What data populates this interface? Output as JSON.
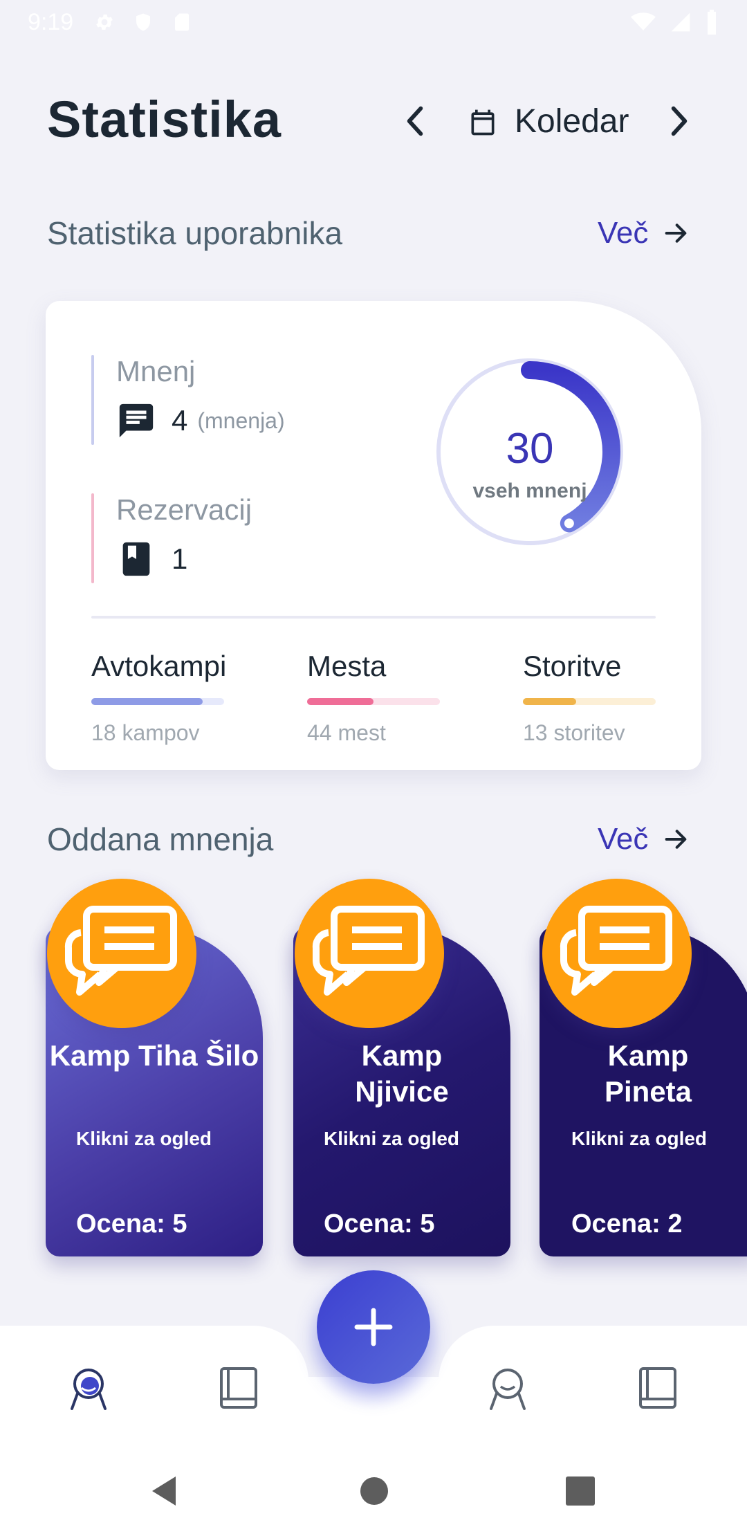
{
  "status_bar": {
    "time": "9:19"
  },
  "header": {
    "title": "Statistika",
    "calendar_label": "Koledar"
  },
  "user_stats": {
    "section_title": "Statistika uporabnika",
    "more_label": "Več",
    "reviews": {
      "label": "Mnenj",
      "value": "4",
      "unit": "(mnenja)"
    },
    "reservations": {
      "label": "Rezervacij",
      "value": "1"
    },
    "ring": {
      "value": "30",
      "caption": "vseh mnenj",
      "progress": 0.42
    },
    "categories": [
      {
        "name": "Avtokampi",
        "sub": "18 kampov",
        "progress": 0.84,
        "color": "#8e9be6",
        "track": "#e6e9fb"
      },
      {
        "name": "Mesta",
        "sub": "44 mest",
        "progress": 0.5,
        "color": "#ef6d97",
        "track": "#fbe1ea"
      },
      {
        "name": "Storitve",
        "sub": "13 storitev",
        "progress": 0.4,
        "color": "#f0b44a",
        "track": "#fcefd6"
      }
    ]
  },
  "submitted_reviews": {
    "section_title": "Oddana mnenja",
    "more_label": "Več",
    "cards": [
      {
        "name": "Kamp Tiha Šilo",
        "hint": "Klikni za ogled",
        "score": "Ocena: 5"
      },
      {
        "name": "Kamp Njivice",
        "hint": "Klikni za ogled",
        "score": "Ocena: 5"
      },
      {
        "name": "Kamp Pineta",
        "hint": "Klikni za ogled",
        "score": "Ocena: 2"
      }
    ]
  },
  "colors": {
    "accent": "#3a35b5",
    "badge": "#ff9f0e"
  }
}
